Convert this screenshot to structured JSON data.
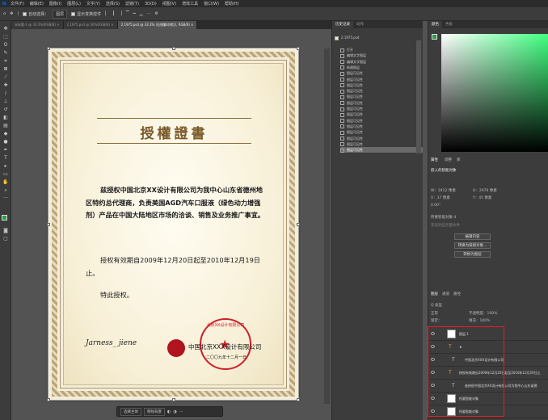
{
  "menubar": {
    "items": [
      "文件(F)",
      "编辑(E)",
      "图像(I)",
      "图层(L)",
      "文字(Y)",
      "选择(S)",
      "滤镜(T)",
      "3D(D)",
      "视图(V)",
      "增效工具",
      "窗口(W)",
      "帮助(H)"
    ]
  },
  "options": {
    "auto_select_label": "自动选择：",
    "auto_select_value": "图层",
    "show_transform": "显示变换控件"
  },
  "tabs": [
    "未标题-1 @ 33.3%(RGB/8) ×",
    "2.1975.psd @ 30%(RGB/8) ×",
    "2.1975.psd @ 33.3% (右侧翻印拷贝, RGB/8) ×"
  ],
  "certificate": {
    "title": "授權證書",
    "para1": "兹授权中国北京XX设计有限公司为我中心山东省德州地区特约总代理商，负责美国AGD汽车口服液（绿色动力增强剂）产品在中国大陆地区市场的洽谈、销售及业务推广事宜。",
    "para2": "授权有效期自2009年12月20日起至2010年12月19日止。",
    "para3": "特此授权。",
    "signature": "Jarness_ jiene",
    "company": "中国北京XXX设计有限公司",
    "date": "二〇〇九年十二月一日",
    "stamp_text": "北京XX设计有限公司"
  },
  "history": {
    "tabs": [
      "历史记录",
      "动作"
    ],
    "snapshot": "2.1975.psd",
    "items": [
      "打开",
      "编辑文字图层",
      "编辑文字图层",
      "新建图层",
      "图层可见性",
      "图层可见性",
      "图层可见性",
      "图层可见性",
      "图层可见性",
      "图层可见性",
      "图层可见性",
      "图层可见性",
      "图层可见性",
      "图层可见性",
      "图层可见性",
      "图层可见性",
      "图层可见性",
      "图层可见性"
    ]
  },
  "right": {
    "color_tabs": [
      "颜色",
      "色板"
    ],
    "props_title": "属性",
    "props_tabs": [
      "调整",
      "库"
    ],
    "embedded": "嵌入的智能对象",
    "w_label": "W：2412 像素",
    "h_label": "H：2976 像素",
    "x_label": "X：37 像素",
    "y_label": "Y：45 像素",
    "angle_label": "0.00°",
    "smart_label": "所要智能对象 4",
    "smart_note": "无法对应外部文件",
    "btn_edit": "编辑内容",
    "btn_convert": "转换为链接对象...",
    "btn_layer": "转换为图层",
    "layers_tabs": [
      "图层",
      "通道",
      "路径"
    ],
    "kind": "Q 类型",
    "mode": "正常",
    "opacity_label": "不透明度：100%",
    "fill_label": "填充：100%",
    "lock_label": "锁定："
  },
  "layers": [
    {
      "name": "图层 1",
      "kind": "thumb"
    },
    {
      "name": "★",
      "kind": "type-fx"
    },
    {
      "name": "中国北京XXX设计有限公司",
      "kind": "type"
    },
    {
      "name": "授权有效期自2009年12月20日起至2010年12月19日止",
      "kind": "type-fx"
    },
    {
      "name": "兹授权中国北京XX设计有限公司为我中心山东省德",
      "kind": "type"
    },
    {
      "name": "所要智能对象",
      "kind": "smart"
    },
    {
      "name": "所要智能对象",
      "kind": "smart"
    }
  ],
  "bottombar": {
    "btn1": "选择主体",
    "btn2": "移除背景"
  }
}
